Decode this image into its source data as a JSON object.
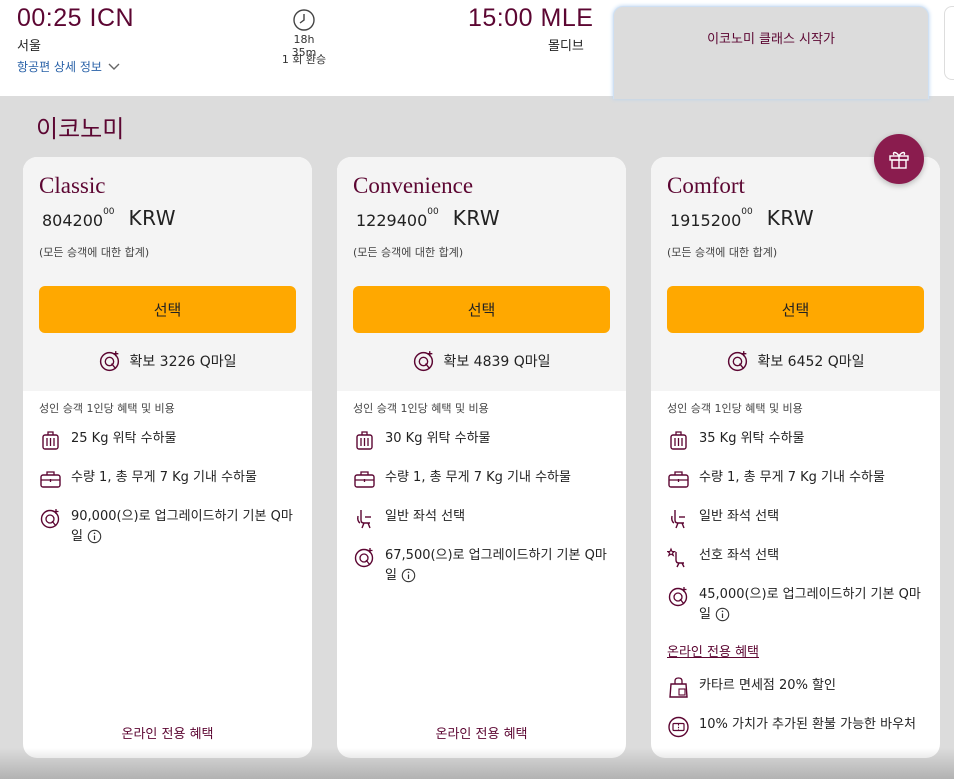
{
  "flight": {
    "departure_time": "00:25 ICN",
    "departure_city": "서울",
    "arrival_time": "15:00 MLE",
    "arrival_city": "몰디브",
    "duration": "18h 35m",
    "stops": "1 회 환승",
    "details_link": "항공편 상세 정보"
  },
  "class_tab": {
    "label": "이코노미 클래스 시작가"
  },
  "section_title": "이코노미",
  "colors": {
    "brand": "#5c0632",
    "accent": "#ffa800",
    "gift": "#8a1c4e"
  },
  "fares": [
    {
      "name": "Classic",
      "amount": "804200",
      "decimals": "00",
      "currency": "KRW",
      "note": "(모든 승객에 대한 합계)",
      "select_label": "선택",
      "qmiles": "확보 3226 Q마일",
      "benefits_heading": "성인 승객 1인당 혜택 및 비용",
      "benefits": [
        {
          "icon": "checked-bag-icon",
          "text": "25 Kg 위탁 수하물"
        },
        {
          "icon": "cabin-bag-icon",
          "text": "수량 1, 총 무게 7 Kg 기내 수하물"
        },
        {
          "icon": "qmiles-icon",
          "text": "90,000(으)로 업그레이드하기 기본 Q마일",
          "info": true
        }
      ],
      "footer_link": "온라인 전용 혜택"
    },
    {
      "name": "Convenience",
      "amount": "1229400",
      "decimals": "00",
      "currency": "KRW",
      "note": "(모든 승객에 대한 합계)",
      "select_label": "선택",
      "qmiles": "확보 4839 Q마일",
      "benefits_heading": "성인 승객 1인당 혜택 및 비용",
      "benefits": [
        {
          "icon": "checked-bag-icon",
          "text": "30 Kg 위탁 수하물"
        },
        {
          "icon": "cabin-bag-icon",
          "text": "수량 1, 총 무게 7 Kg 기내 수하물"
        },
        {
          "icon": "seat-icon",
          "text": "일반 좌석 선택"
        },
        {
          "icon": "qmiles-icon",
          "text": "67,500(으)로 업그레이드하기 기본 Q마일",
          "info": true
        }
      ],
      "footer_link": "온라인 전용 혜택"
    },
    {
      "name": "Comfort",
      "amount": "1915200",
      "decimals": "00",
      "currency": "KRW",
      "note": "(모든 승객에 대한 합계)",
      "select_label": "선택",
      "qmiles": "확보 6452 Q마일",
      "benefits_heading": "성인 승객 1인당 혜택 및 비용",
      "benefits": [
        {
          "icon": "checked-bag-icon",
          "text": "35 Kg 위탁 수하물"
        },
        {
          "icon": "cabin-bag-icon",
          "text": "수량 1, 총 무게 7 Kg 기내 수하물"
        },
        {
          "icon": "seat-icon",
          "text": "일반 좌석 선택"
        },
        {
          "icon": "preferred-seat-icon",
          "text": "선호 좌석 선택"
        },
        {
          "icon": "qmiles-icon",
          "text": "45,000(으)로 업그레이드하기 기본 Q마일",
          "info": true
        }
      ],
      "online_link": "온라인 전용 혜택",
      "online_benefits": [
        {
          "icon": "duty-free-bag-icon",
          "text": "카타르 면세점 20% 할인"
        },
        {
          "icon": "voucher-icon",
          "text": "10% 가치가 추가된 환불 가능한 바우처"
        }
      ]
    }
  ]
}
